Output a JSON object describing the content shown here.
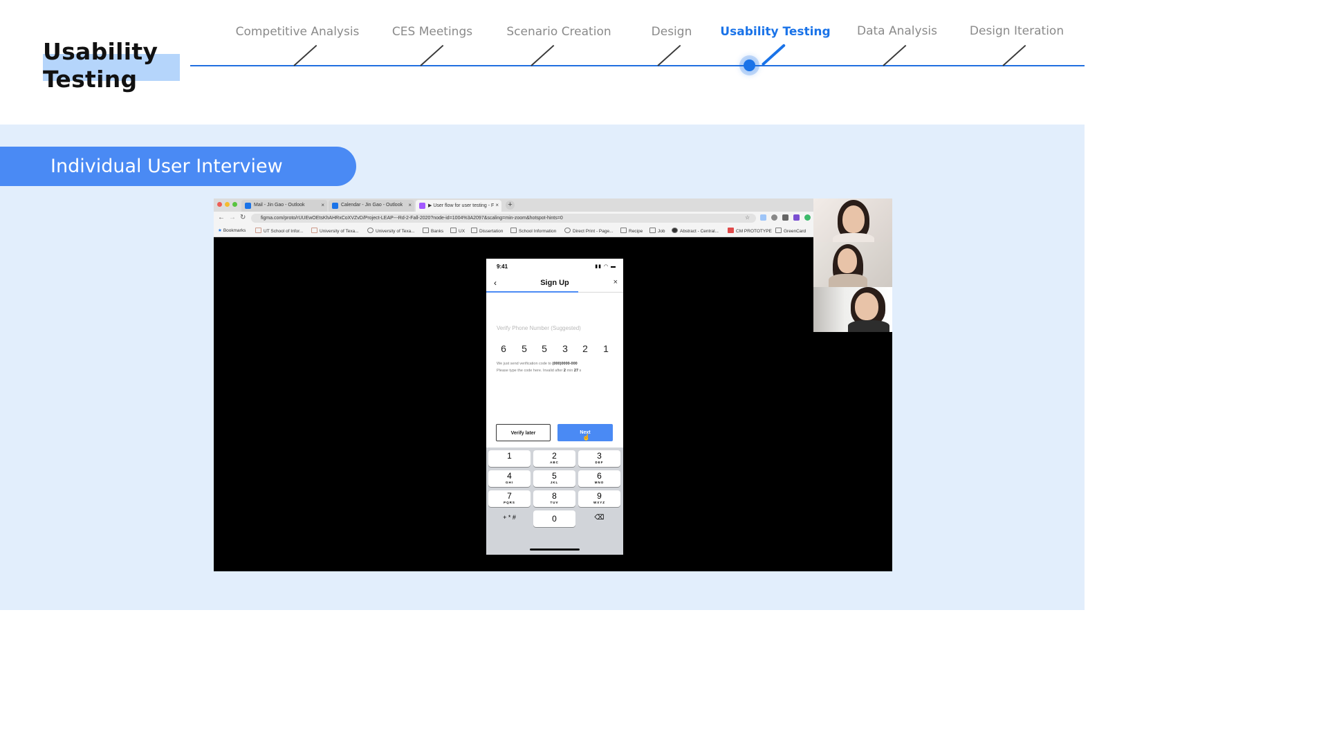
{
  "header": {
    "page_title": "Usability Testing",
    "steps": [
      {
        "label": "Competitive Analysis",
        "active": false
      },
      {
        "label": "CES Meetings",
        "active": false
      },
      {
        "label": "Scenario Creation",
        "active": false
      },
      {
        "label": "Design",
        "active": false
      },
      {
        "label": "Usability Testing",
        "active": true
      },
      {
        "label": "Data Analysis",
        "active": false
      },
      {
        "label": "Design Iteration",
        "active": false
      }
    ]
  },
  "section": {
    "heading": "Individual User Interview"
  },
  "browser": {
    "tabs": [
      {
        "title": "Mail - Jin Gao - Outlook",
        "favicon_color": "#1a73e8"
      },
      {
        "title": "Calendar - Jin Gao - Outlook",
        "favicon_color": "#1a73e8"
      },
      {
        "title": "▶ User flow for user testing - F",
        "favicon_color": "#a259ff"
      }
    ],
    "new_tab": "+",
    "url": "figma.com/proto/rUUEwOEtsKhAHRxCoXVZvD/Project-LEAP---Rd-2-Fall-2020?node-id=1004%3A2097&scaling=min-zoom&hotspot-hints=0",
    "bookmarks": [
      "Bookmarks",
      "UT School of Infor...",
      "University of Texa...",
      "University of Texa...",
      "Banks",
      "UX",
      "Dissertation",
      "School Information",
      "Direct Print - Page...",
      "Recipe",
      "Job",
      "Abstract - Central...",
      "CM PROTOTYPE",
      "GreenCard"
    ]
  },
  "phone": {
    "time": "9:41",
    "screen_title": "Sign Up",
    "back_icon": "‹",
    "close_icon": "×",
    "field_label": "Verify Phone Number (Suggested)",
    "code_digits": [
      "6",
      "5",
      "5",
      "3",
      "2",
      "1"
    ],
    "note_line1_prefix": "We just send verification code to ",
    "note_line1_phone": "(000)0000-000",
    "note_line2_prefix": "Please type the code here. Invalid after ",
    "note_line2_min": "2",
    "note_line2_mid": " min ",
    "note_line2_sec": "27",
    "note_line2_suffix": " s",
    "verify_later_label": "Verify later",
    "next_label": "Next",
    "keypad": [
      {
        "num": "1",
        "letters": ""
      },
      {
        "num": "2",
        "letters": "ABC"
      },
      {
        "num": "3",
        "letters": "DEF"
      },
      {
        "num": "4",
        "letters": "GHI"
      },
      {
        "num": "5",
        "letters": "JKL"
      },
      {
        "num": "6",
        "letters": "MNO"
      },
      {
        "num": "7",
        "letters": "PQRS"
      },
      {
        "num": "8",
        "letters": "TUV"
      },
      {
        "num": "9",
        "letters": "WXYZ"
      },
      {
        "num": "+ * #",
        "letters": ""
      },
      {
        "num": "0",
        "letters": ""
      },
      {
        "num": "⌫",
        "letters": ""
      }
    ]
  },
  "colors": {
    "accent": "#1a73e8",
    "pill": "#4a8af4",
    "section_bg": "#e2eefc",
    "title_highlight": "#b5d5fb"
  }
}
